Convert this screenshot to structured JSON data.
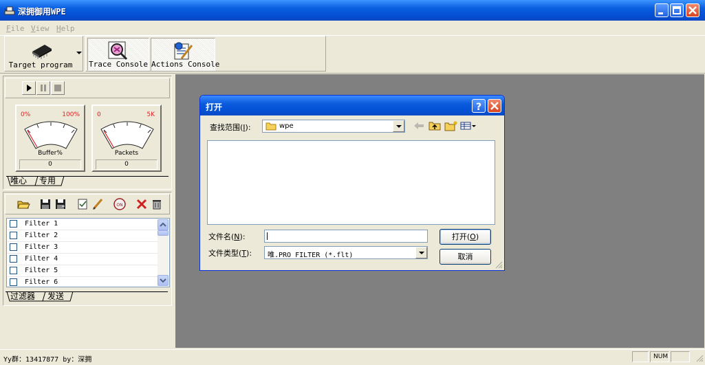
{
  "window": {
    "title": "深拥御用WPE"
  },
  "menu": [
    {
      "key": "F",
      "rest": "ile"
    },
    {
      "key": "V",
      "rest": "iew"
    },
    {
      "key": "H",
      "rest": "elp"
    }
  ],
  "toolbar": {
    "target_label": "Target program",
    "trace_label": "Trace Console",
    "actions_label": "Actions Console"
  },
  "gauges": {
    "buffer": {
      "min": "0%",
      "max": "100%",
      "caption": "Buffer%",
      "value": "0"
    },
    "packets": {
      "min": "0",
      "max": "5K",
      "caption": "Packets",
      "value": "0"
    }
  },
  "top_tabs": [
    "唯心",
    "专用"
  ],
  "filters": [
    "Filter 1",
    "Filter 2",
    "Filter 3",
    "Filter 4",
    "Filter 5",
    "Filter 6"
  ],
  "bottom_tabs": [
    "过滤器",
    "发送"
  ],
  "dialog": {
    "title": "打开",
    "lookin_label": "查找范围",
    "lookin_key": "I",
    "lookin_value": "wpe",
    "filename_label": "文件名",
    "filename_key": "N",
    "filename_value": "",
    "filetype_label": "文件类型",
    "filetype_key": "T",
    "filetype_value": "唯.PRO FILTER (*.flt)",
    "open_button": "打开",
    "open_key": "O",
    "cancel_button": "取消"
  },
  "status": {
    "text": "Yy群：13417877  by：深拥",
    "num": "NUM"
  },
  "colors": {
    "titlebar": "#0551d6",
    "workspace": "#808080",
    "face": "#ece9d8"
  }
}
